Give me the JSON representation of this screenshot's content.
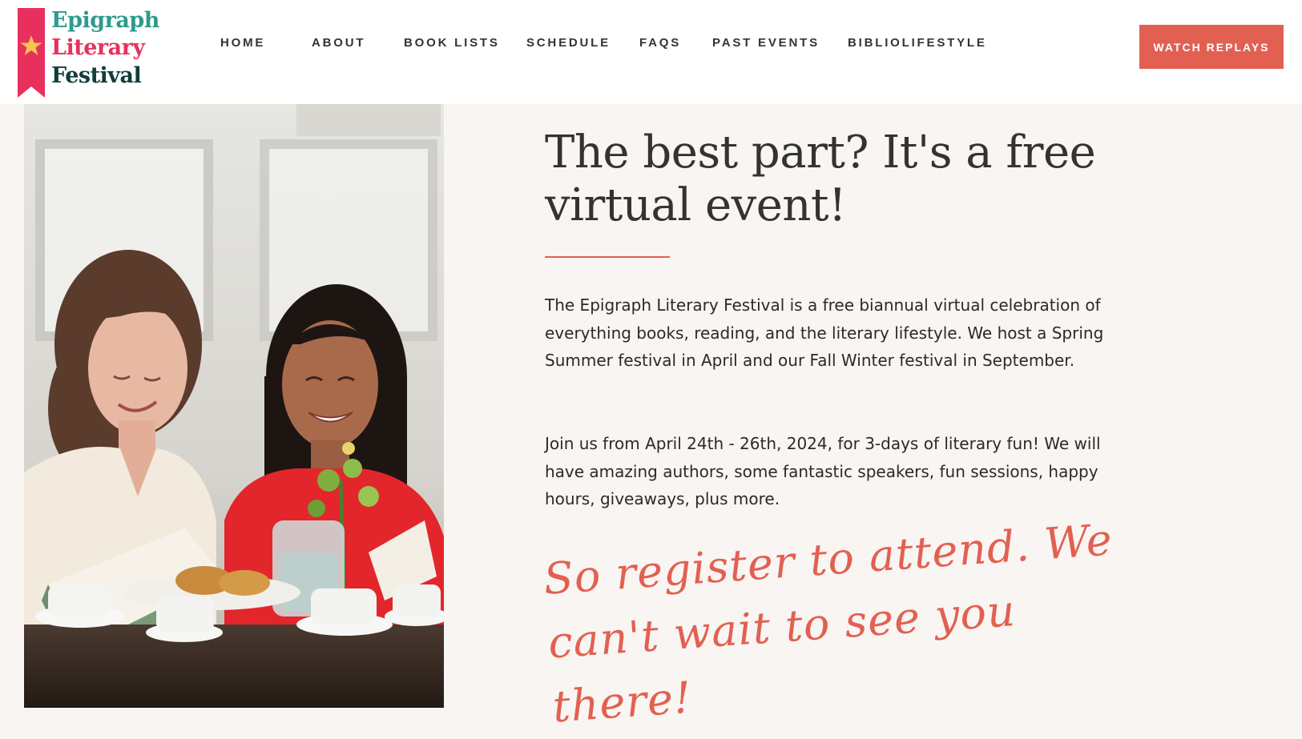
{
  "logo": {
    "line1": "Epigraph",
    "line2": "Literary",
    "line3": "Festival",
    "colors": {
      "ribbon": "#e8305f",
      "line1": "#2e9b8c",
      "line2": "#e8305f",
      "line3": "#0f3e3c",
      "star": "#f5c451"
    }
  },
  "nav": {
    "items": [
      {
        "label": "HOME"
      },
      {
        "label": "ABOUT"
      },
      {
        "label": "BOOK LISTS"
      },
      {
        "label": "SCHEDULE"
      },
      {
        "label": "FAQS"
      },
      {
        "label": "PAST EVENTS"
      },
      {
        "label": "BIBLIOLIFESTYLE"
      }
    ],
    "cta_label": "WATCH REPLAYS"
  },
  "main": {
    "headline": "The best part?  It's a free virtual event!",
    "paragraph_1": "The Epigraph Literary Festival is a free biannual virtual celebration of everything books, reading, and the literary lifestyle.  We host a Spring Summer festival in April and our Fall Winter festival in September.",
    "paragraph_2": "Join us from April 24th - 26th, 2024, for 3-days of literary fun! We will have amazing authors, some fantastic speakers, fun sessions, happy hours, giveaways, plus more.",
    "script_line": "So register to attend. We can't wait to see you there!"
  },
  "colors": {
    "accent": "#e26052",
    "page_background": "#f8f5f2",
    "header_background": "#ffffff",
    "text": "#2a2a2a"
  }
}
